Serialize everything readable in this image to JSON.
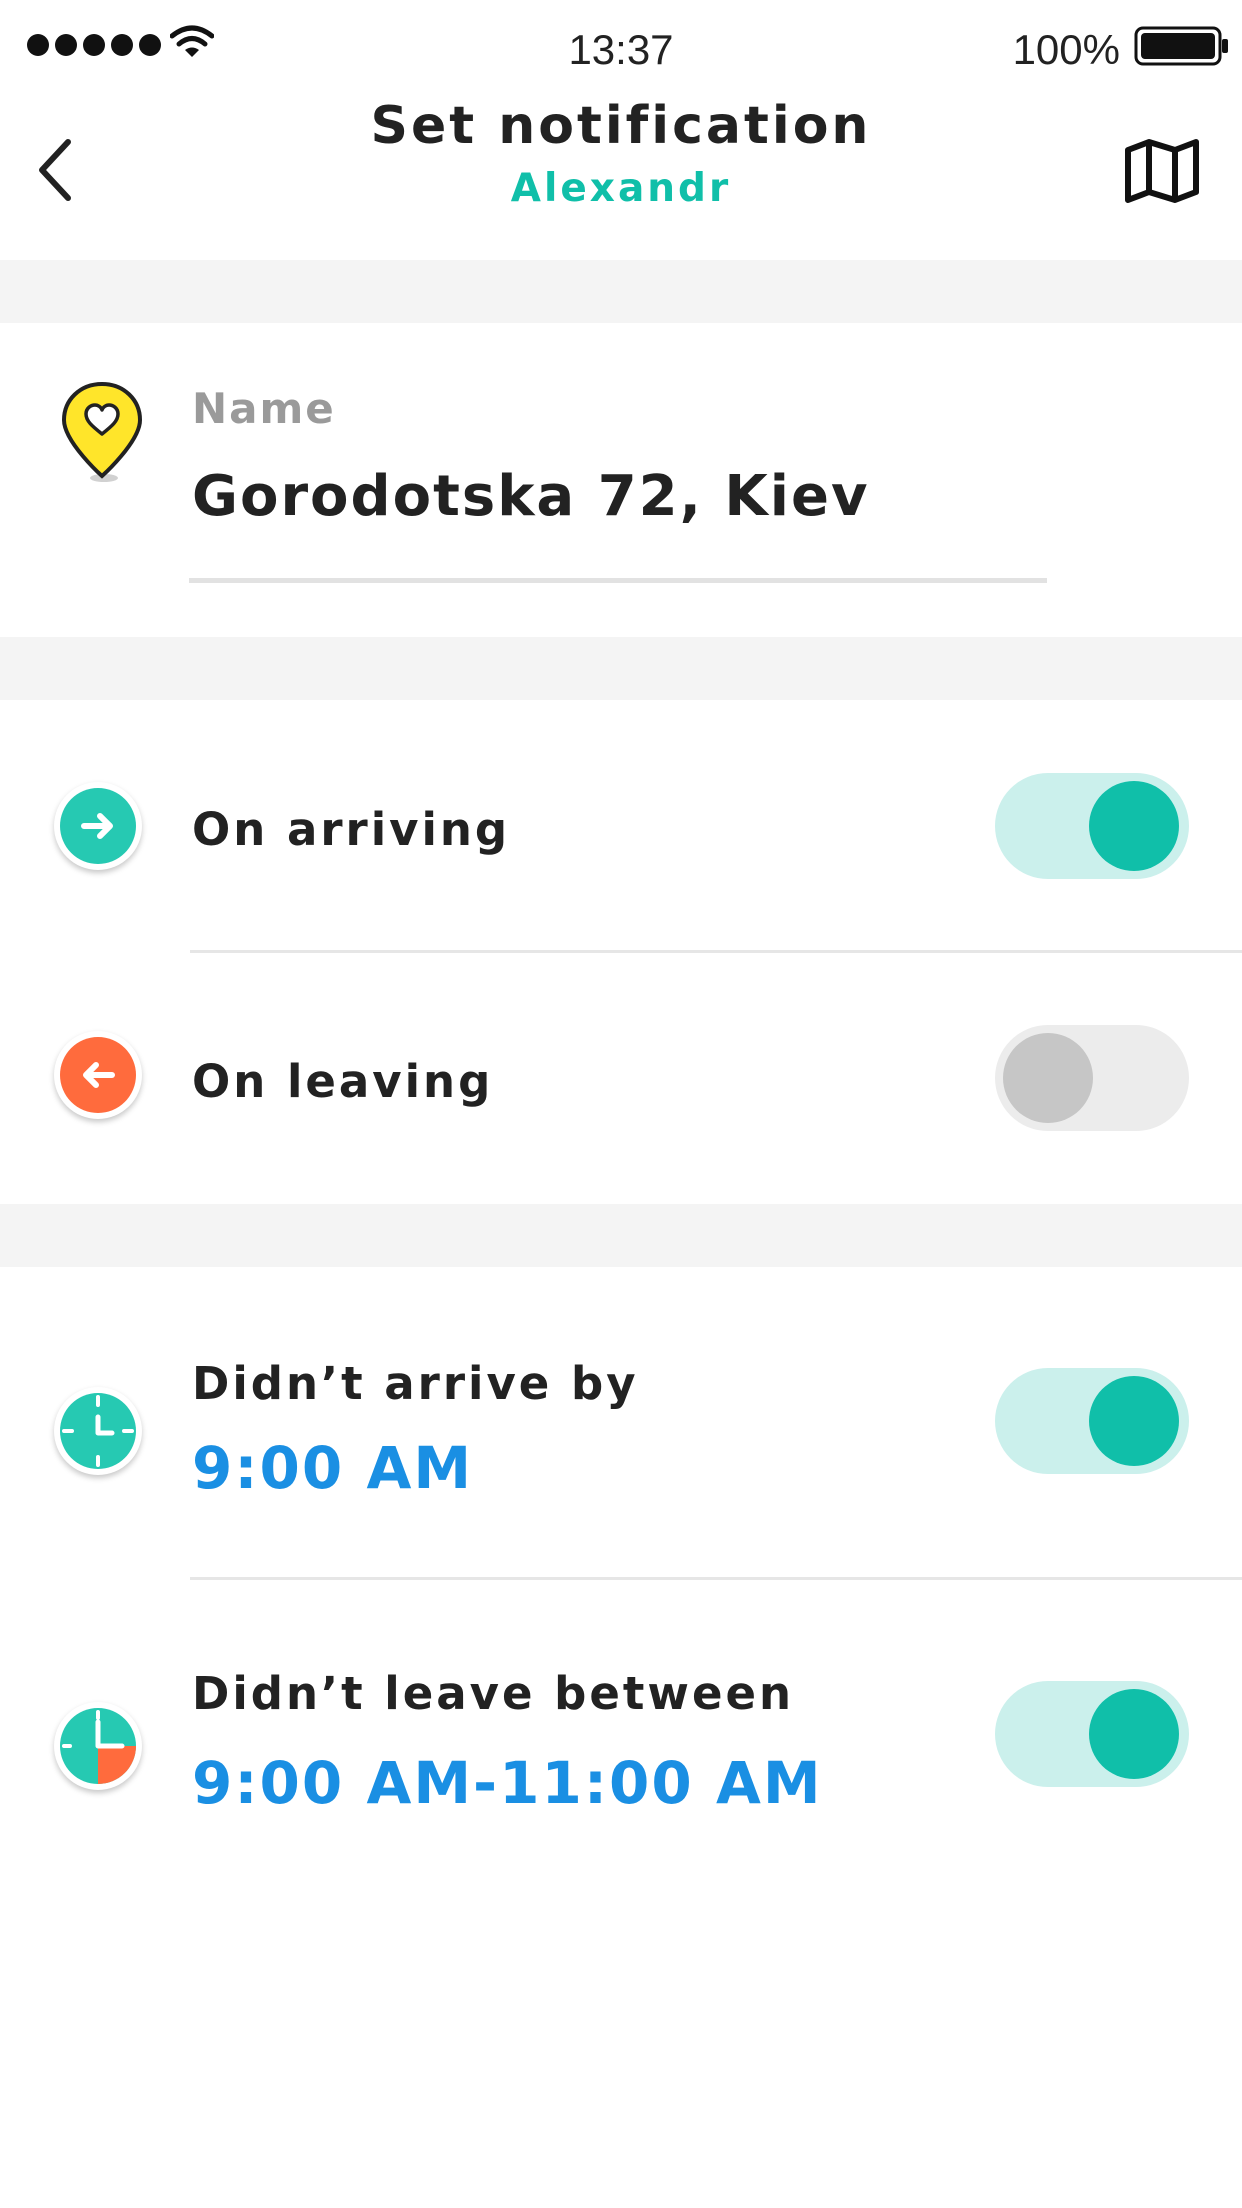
{
  "status_bar": {
    "time": "13:37",
    "battery_percent": "100%"
  },
  "nav": {
    "title": "Set notification",
    "subtitle": "Alexandr",
    "back_icon": "chevron-left-icon",
    "map_icon": "map-icon"
  },
  "place": {
    "icon": "heart-pin-icon",
    "label": "Name",
    "value": "Gorodotska 72, Kiev"
  },
  "location_alerts": [
    {
      "label": "On arriving",
      "icon": "arrow-right-circle-icon",
      "enabled": true
    },
    {
      "label": "On leaving",
      "icon": "arrow-left-circle-icon",
      "enabled": false
    }
  ],
  "time_alerts": [
    {
      "label": "Didn’t arrive by",
      "time": "9:00 AM",
      "icon": "clock-icon",
      "enabled": true
    },
    {
      "label": "Didn’t leave between",
      "time": "9:00 AM-11:00 AM",
      "icon": "clock-range-icon",
      "enabled": true
    }
  ],
  "colors": {
    "accent": "#10bfa9",
    "time_blue": "#1a8fe3",
    "leave_orange": "#ff6b3d",
    "pin_yellow": "#ffe52a",
    "toggle_on_track": "#cbf0ec",
    "toggle_off_track": "#ececec",
    "band_gray": "#f4f4f4"
  }
}
